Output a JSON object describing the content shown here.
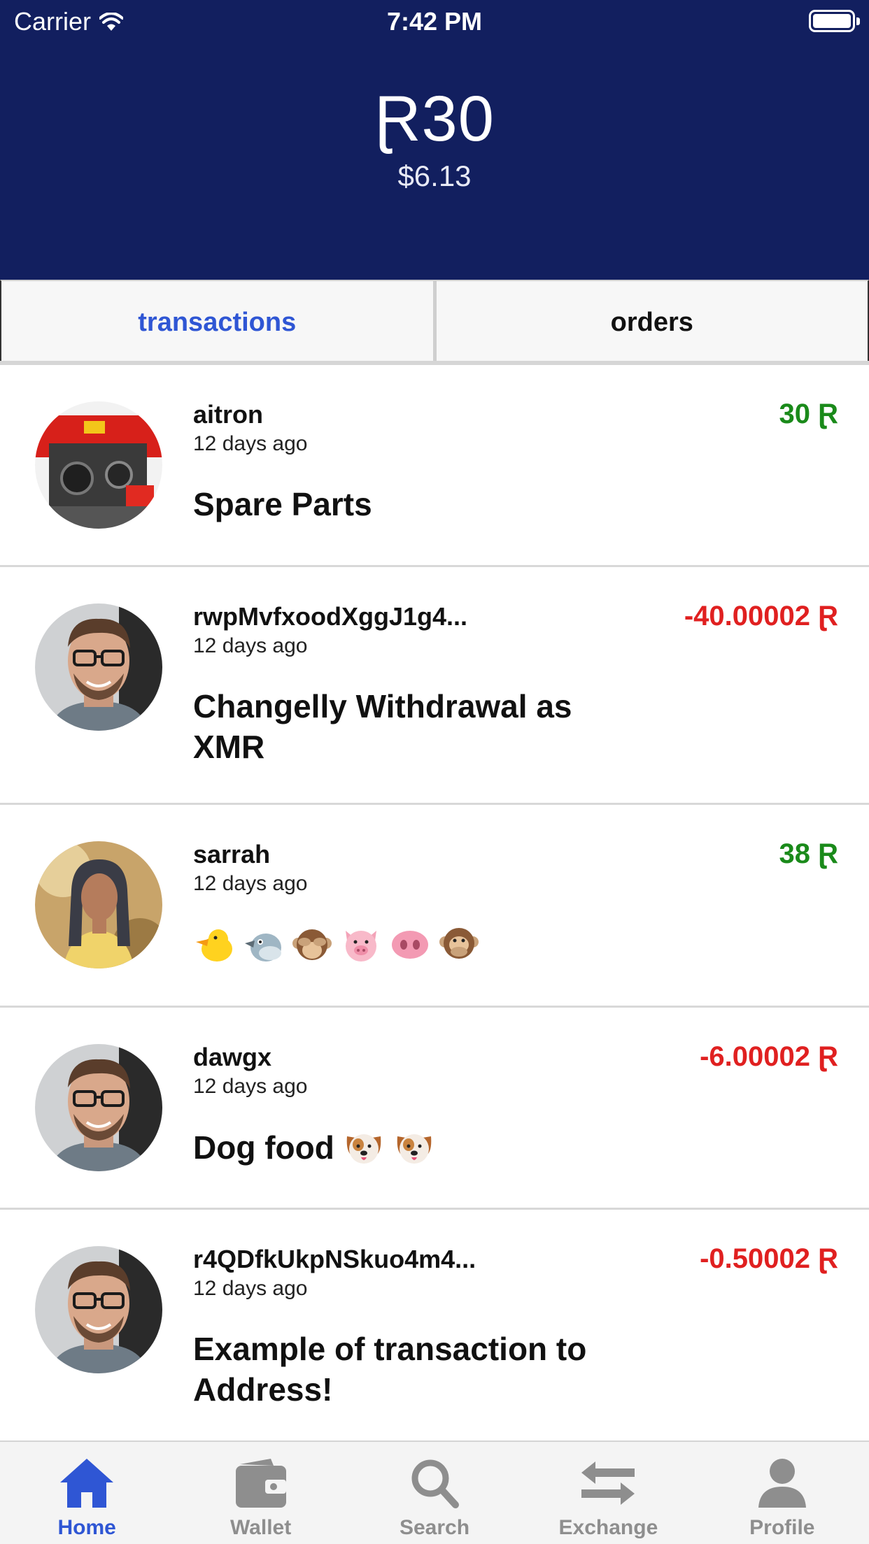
{
  "status_bar": {
    "carrier": "Carrier",
    "time": "7:42 PM"
  },
  "balance": {
    "amount": "Ɽ30",
    "fiat": "$6.13"
  },
  "tabs": [
    {
      "label": "transactions",
      "active": true
    },
    {
      "label": "orders",
      "active": false
    }
  ],
  "transactions": [
    {
      "user": "aitron",
      "time": "12 days ago",
      "amount": "30 Ɽ",
      "direction": "in",
      "memo": "Spare Parts",
      "avatar": "car-parts-photo"
    },
    {
      "user": "rwpMvfxoodXggJ1g4...",
      "time": "12 days ago",
      "amount": "-40.00002 Ɽ",
      "direction": "out",
      "memo": "Changelly Withdrawal as XMR",
      "avatar": "man-glasses-photo"
    },
    {
      "user": "sarrah",
      "time": "12 days ago",
      "amount": "38 Ɽ",
      "direction": "in",
      "memo_emojis": [
        "chick",
        "bird",
        "see-no-evil-monkey",
        "pig-face",
        "pig-nose",
        "speak-no-evil-monkey"
      ],
      "avatar": "woman-photo"
    },
    {
      "user": "dawgx",
      "time": "12 days ago",
      "amount": "-6.00002 Ɽ",
      "direction": "out",
      "memo": "Dog food",
      "memo_emojis": [
        "dog-face",
        "dog-face"
      ],
      "avatar": "man-glasses-photo"
    },
    {
      "user": "r4QDfkUkpNSkuo4m4...",
      "time": "12 days ago",
      "amount": "-0.50002 Ɽ",
      "direction": "out",
      "memo": "Example of transaction to Address!",
      "avatar": "man-glasses-photo"
    }
  ],
  "tabbar": [
    {
      "label": "Home",
      "icon": "home-icon",
      "active": true
    },
    {
      "label": "Wallet",
      "icon": "wallet-icon",
      "active": false
    },
    {
      "label": "Search",
      "icon": "search-icon",
      "active": false
    },
    {
      "label": "Exchange",
      "icon": "exchange-icon",
      "active": false
    },
    {
      "label": "Profile",
      "icon": "profile-icon",
      "active": false
    }
  ],
  "colors": {
    "header_bg": "#121f5f",
    "accent": "#2f56d4",
    "positive": "#1a8a1a",
    "negative": "#e02020"
  }
}
